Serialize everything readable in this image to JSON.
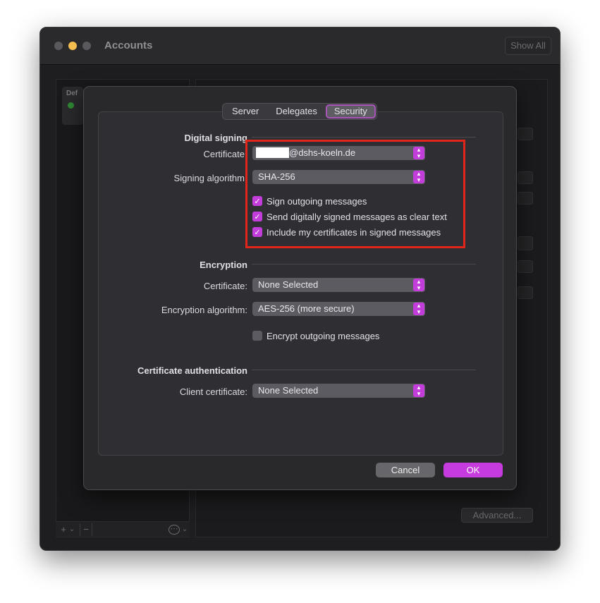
{
  "window": {
    "title": "Accounts",
    "show_all_label": "Show All",
    "account_item_text": "Def",
    "advanced_label": "Advanced..."
  },
  "left_toolbar": {
    "add": "+",
    "add_menu": "⌄",
    "remove": "−",
    "more": "⋯",
    "more_menu": "⌄"
  },
  "tabs": [
    {
      "label": "Server",
      "active": false
    },
    {
      "label": "Delegates",
      "active": false
    },
    {
      "label": "Security",
      "active": true
    }
  ],
  "digital_signing": {
    "section_title": "Digital signing",
    "certificate_label": "Certificate",
    "certificate_value": "@dshs-koeln.de",
    "algorithm_label": "Signing algorithm",
    "algorithm_value": "SHA-256",
    "options": [
      {
        "label": "Sign outgoing messages",
        "checked": true
      },
      {
        "label": "Send digitally signed messages as clear text",
        "checked": true
      },
      {
        "label": "Include my certificates in signed messages",
        "checked": true
      }
    ]
  },
  "encryption": {
    "section_title": "Encryption",
    "certificate_label": "Certificate:",
    "certificate_value": "None Selected",
    "algorithm_label": "Encryption algorithm:",
    "algorithm_value": "AES-256 (more secure)",
    "encrypt_label": "Encrypt outgoing messages",
    "encrypt_checked": false
  },
  "cert_auth": {
    "section_title": "Certificate authentication",
    "client_label": "Client certificate:",
    "client_value": "None Selected"
  },
  "buttons": {
    "cancel": "Cancel",
    "ok": "OK"
  },
  "icons": {
    "checkmark": "✓",
    "popup_chevron": "up-down-chevron-icon"
  },
  "colors": {
    "accent": "#c33ddb",
    "highlight_box": "#e1251b",
    "traffic_yellow": "#f4bf4f"
  }
}
